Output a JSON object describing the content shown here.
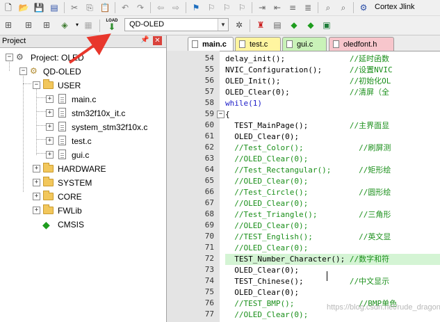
{
  "toolbar_top": {
    "cortex_label": "Cortex Jlink"
  },
  "toolbar_build": {
    "target": "QD-OLED",
    "load_label": "LOAD"
  },
  "project_panel": {
    "title": "Project",
    "tree": {
      "project": "Project: OLED",
      "target": "QD-OLED",
      "groups": [
        {
          "name": "USER",
          "files": [
            "main.c",
            "stm32f10x_it.c",
            "system_stm32f10x.c",
            "test.c",
            "gui.c"
          ]
        },
        {
          "name": "HARDWARE"
        },
        {
          "name": "SYSTEM"
        },
        {
          "name": "CORE"
        },
        {
          "name": "FWLib"
        },
        {
          "name": "CMSIS"
        }
      ]
    }
  },
  "editor": {
    "tabs": [
      {
        "label": "main.c",
        "color": "#ffffff",
        "active": true
      },
      {
        "label": "test.c",
        "color": "#fff5a0",
        "active": false
      },
      {
        "label": "gui.c",
        "color": "#c9f2b8",
        "active": false
      },
      {
        "label": "oledfont.h",
        "color": "#f7c6cc",
        "active": false
      }
    ],
    "lines": [
      {
        "n": "54",
        "code": "delay_init();",
        "comment": "//延时函数",
        "pad": 0
      },
      {
        "n": "55",
        "code": "NVIC_Configuration();",
        "comment": "//设置NVIC",
        "pad": 0
      },
      {
        "n": "56",
        "code": "OLED_Init();",
        "comment": "//初始化OL",
        "pad": 0
      },
      {
        "n": "57",
        "code": "OLED_Clear(0);",
        "comment": "//清屏（全",
        "pad": 0
      },
      {
        "n": "58",
        "code": "while(1)",
        "comment": "",
        "pad": 0,
        "kw": true
      },
      {
        "n": "59",
        "code": "{",
        "comment": "",
        "pad": 0
      },
      {
        "n": "60",
        "code": "TEST_MainPage();",
        "comment": "//主界面显",
        "pad": 1
      },
      {
        "n": "61",
        "code": "OLED_Clear(0);",
        "comment": "",
        "pad": 1
      },
      {
        "n": "62",
        "code": "",
        "comment": "//Test_Color();",
        "comment2": "//刷屏测",
        "pad": 1
      },
      {
        "n": "63",
        "code": "",
        "comment": "//OLED_Clear(0);",
        "pad": 1
      },
      {
        "n": "64",
        "code": "",
        "comment": "//Test_Rectangular();",
        "comment2": "//矩形绘",
        "pad": 1
      },
      {
        "n": "65",
        "code": "",
        "comment": "//OLED_Clear(0);",
        "pad": 1
      },
      {
        "n": "66",
        "code": "",
        "comment": "//Test_Circle();",
        "comment2": "//圆形绘",
        "pad": 1
      },
      {
        "n": "67",
        "code": "",
        "comment": "//OLED_Clear(0);",
        "pad": 1
      },
      {
        "n": "68",
        "code": "",
        "comment": "//Test_Triangle();",
        "comment2": "//三角形",
        "pad": 1
      },
      {
        "n": "69",
        "code": "",
        "comment": "//OLED_Clear(0);",
        "pad": 1
      },
      {
        "n": "70",
        "code": "",
        "comment": "//TEST_English();",
        "comment2": "//英文显",
        "pad": 1
      },
      {
        "n": "71",
        "code": "",
        "comment": "//OLED_Clear(0);",
        "pad": 1
      },
      {
        "n": "72",
        "code": "TEST_Number_Character();",
        "comment": "//数字和符",
        "pad": 1,
        "highlight": true
      },
      {
        "n": "73",
        "code": "OLED_Clear(0);",
        "comment": "",
        "pad": 1
      },
      {
        "n": "74",
        "code": "TEST_Chinese();",
        "comment": "//中文显示",
        "pad": 1
      },
      {
        "n": "75",
        "code": "OLED_Clear(0);",
        "comment": "",
        "pad": 1
      },
      {
        "n": "76",
        "code": "",
        "comment": "//TEST_BMP();",
        "comment2": "//BMP单色",
        "pad": 1
      },
      {
        "n": "77",
        "code": "",
        "comment": "//OLED_Clear(0);",
        "pad": 1
      }
    ]
  },
  "watermark": "https://blog.csdn.net/rude_dragon",
  "annotation_color": "#e8372c"
}
